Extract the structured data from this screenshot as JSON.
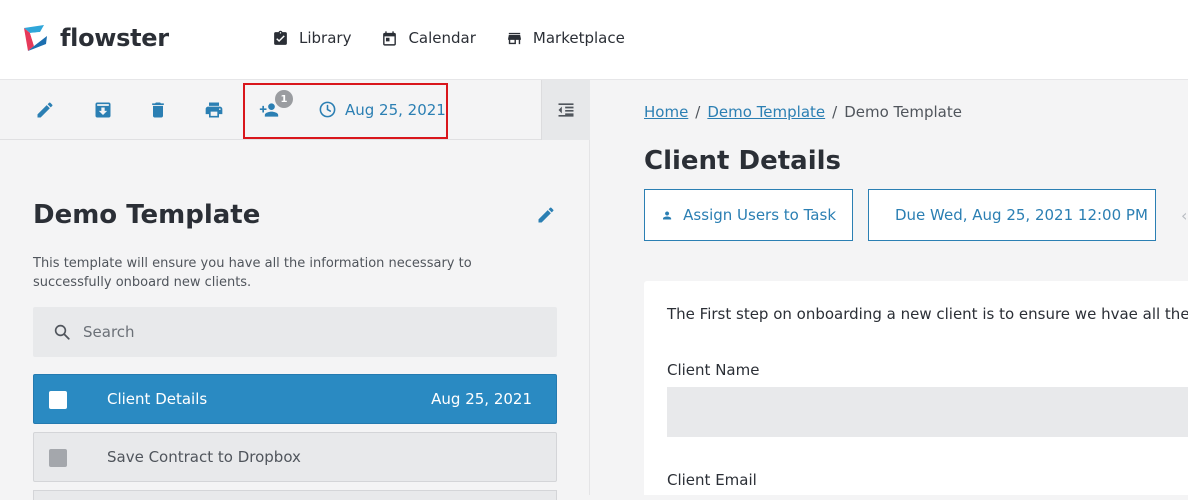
{
  "app": {
    "name": "flowster"
  },
  "nav": {
    "items": [
      {
        "label": "Library",
        "icon": "library-icon"
      },
      {
        "label": "Calendar",
        "icon": "calendar-icon"
      },
      {
        "label": "Marketplace",
        "icon": "marketplace-icon"
      }
    ]
  },
  "toolbar": {
    "assigned_count": "1",
    "due_date": "Aug 25, 2021"
  },
  "template": {
    "title": "Demo Template",
    "description": "This template will ensure you have all the information necessary to successfully onboard new clients."
  },
  "search": {
    "placeholder": "Search"
  },
  "tasks": [
    {
      "label": "Client Details",
      "date": "Aug 25, 2021",
      "active": true
    },
    {
      "label": "Save Contract to Dropbox",
      "date": "",
      "active": false
    }
  ],
  "breadcrumb": {
    "items": [
      "Home",
      "Demo Template",
      "Demo Template"
    ],
    "separator": "/"
  },
  "task_detail": {
    "title": "Client Details",
    "assign_label": "Assign Users to Task",
    "due_label": "Due Wed, Aug 25, 2021 12:00 PM",
    "intro": "The First step on onboarding a new client is to ensure we hvae all the c",
    "fields": [
      {
        "label": "Client Name",
        "value": ""
      },
      {
        "label": "Client Email",
        "value": ""
      }
    ]
  },
  "colors": {
    "accent": "#2b7fb3",
    "active_task": "#2a8ac2",
    "highlight": "#d9161c",
    "badge": "#9a9ca0"
  }
}
